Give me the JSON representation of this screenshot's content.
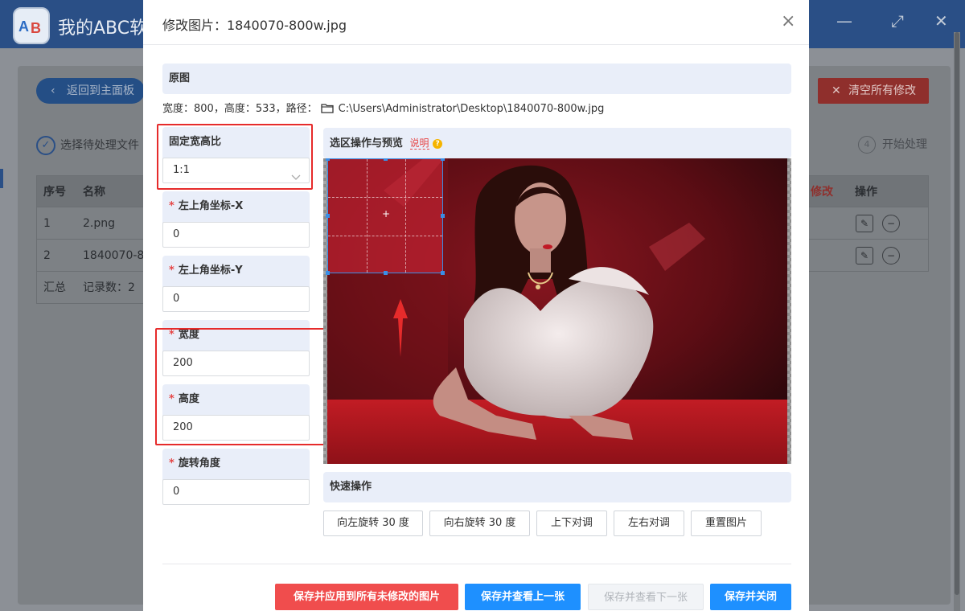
{
  "app": {
    "title": "我的ABC软",
    "back_label": "返回到主面板",
    "clear_label": "清空所有修改",
    "step1_label": "选择待处理文件",
    "step4_number": "4",
    "step4_label": "开始处理",
    "table": {
      "headers": {
        "index": "序号",
        "name": "名称",
        "modify": "修改",
        "actions": "操作"
      },
      "rows": [
        {
          "index": "1",
          "name": "2.png"
        },
        {
          "index": "2",
          "name": "1840070-80"
        }
      ],
      "summary": {
        "label": "汇总",
        "count": "记录数：2"
      }
    }
  },
  "modal": {
    "title": "修改图片：1840070-800w.jpg",
    "close_icon": "×",
    "original": {
      "section_label": "原图",
      "info": "宽度：800，高度：533，路径：",
      "path": "C:\\Users\\Administrator\\Desktop\\1840070-800w.jpg"
    },
    "fields": {
      "aspect": {
        "label": "固定宽高比",
        "value": "1:1"
      },
      "x": {
        "label": "左上角坐标-X",
        "value": "0"
      },
      "y": {
        "label": "左上角坐标-Y",
        "value": "0"
      },
      "width": {
        "label": "宽度",
        "value": "200"
      },
      "height": {
        "label": "高度",
        "value": "200"
      },
      "rotate": {
        "label": "旋转角度",
        "value": "0"
      }
    },
    "preview": {
      "section_label": "选区操作与预览",
      "help_link": "说明",
      "help_icon": "?"
    },
    "quick": {
      "section_label": "快速操作",
      "buttons": [
        "向左旋转 30 度",
        "向右旋转 30 度",
        "上下对调",
        "左右对调",
        "重置图片"
      ]
    },
    "footer": {
      "apply_all": "保存并应用到所有未修改的图片",
      "prev": "保存并查看上一张",
      "next": "保存并查看下一张",
      "close": "保存并关闭"
    }
  },
  "colors": {
    "primary": "#1e90ff",
    "danger": "#f04d4d",
    "disabled": "#f2f4f7",
    "section_bg": "#e9eef9",
    "highlight": "#e62b2b"
  }
}
